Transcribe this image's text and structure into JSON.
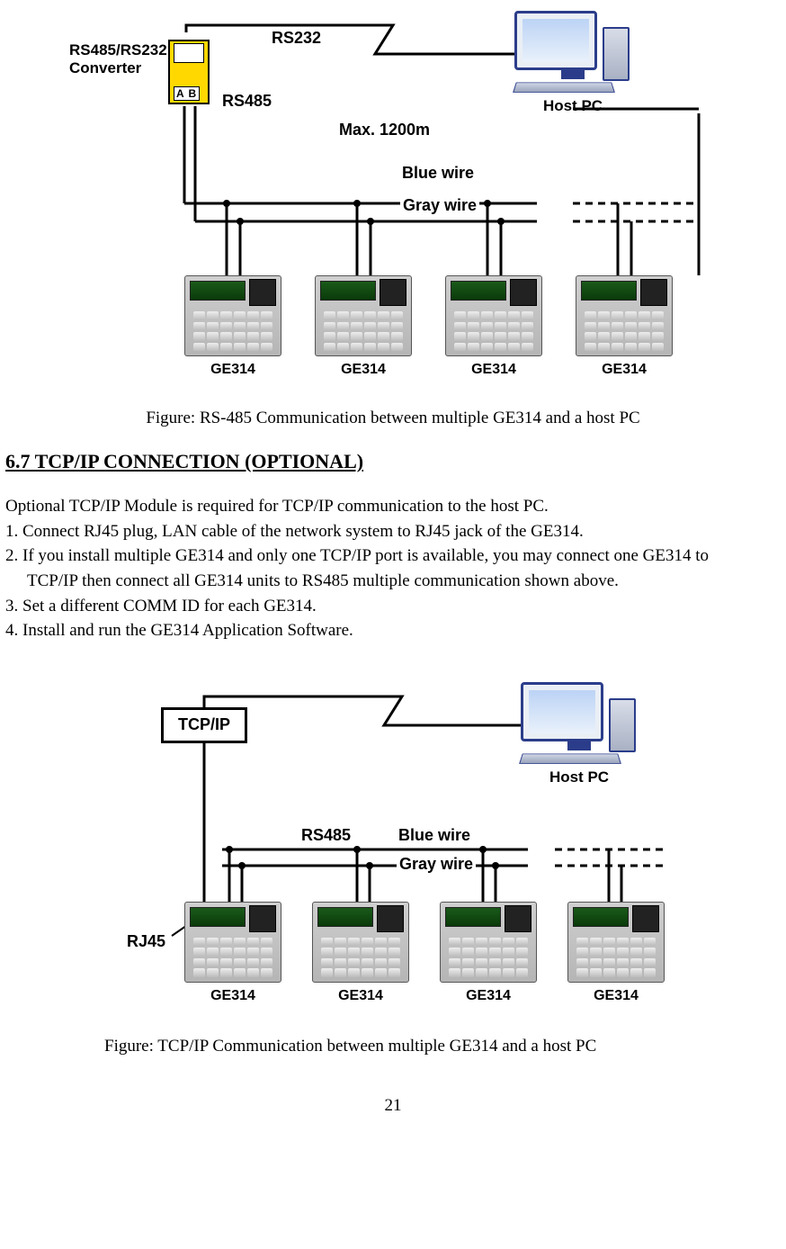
{
  "figure1": {
    "converter_title_l1": "RS485/RS232",
    "converter_title_l2": "Converter",
    "conv_ab": "A B",
    "rs232": "RS232",
    "rs485": "RS485",
    "max": "Max. 1200m",
    "blue": "Blue wire",
    "gray": "Gray wire",
    "host": "Host PC",
    "device": "GE314",
    "caption": "Figure: RS-485 Communication between multiple GE314 and a host PC"
  },
  "section": {
    "heading": "6.7 TCP/IP CONNECTION (OPTIONAL)",
    "p0": "Optional TCP/IP Module is required for TCP/IP communication to the host PC.",
    "p1": "1. Connect RJ45 plug, LAN cable of the network system to RJ45 jack of the GE314.",
    "p2a": "2. If you install multiple GE314 and only one TCP/IP port is available, you may connect one GE314 to",
    "p2b": "TCP/IP then connect all GE314 units to RS485 multiple communication shown above.",
    "p3": "3. Set a different COMM ID for each GE314.",
    "p4": "4. Install and run the GE314 Application Software."
  },
  "figure2": {
    "tcpip": "TCP/IP",
    "host": "Host PC",
    "rs485": "RS485",
    "blue": "Blue wire",
    "gray": "Gray wire",
    "rj45": "RJ45",
    "device": "GE314",
    "caption": "Figure: TCP/IP Communication between multiple GE314 and a host PC"
  },
  "page_number": "21"
}
